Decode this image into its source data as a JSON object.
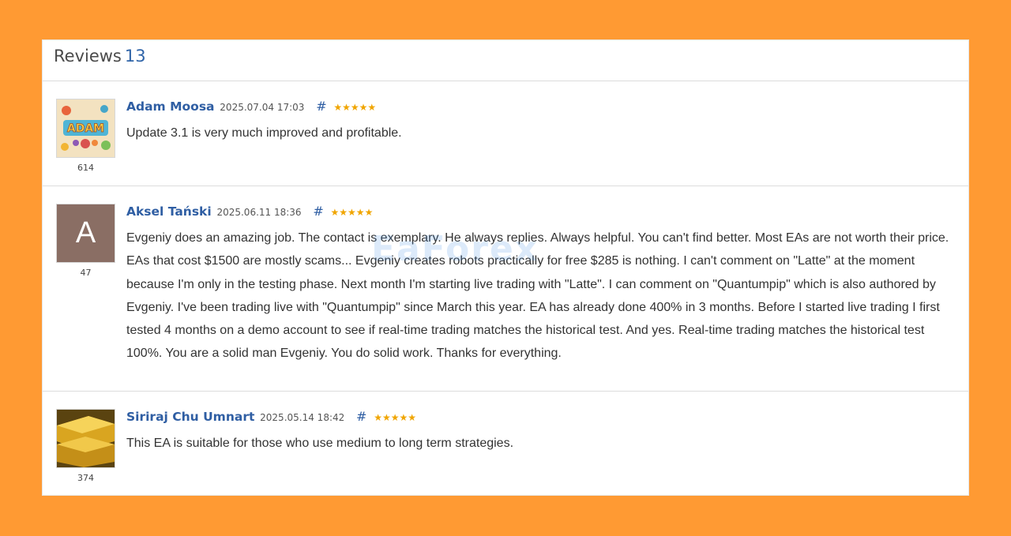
{
  "header": {
    "title": "Reviews",
    "count": "13"
  },
  "watermark": "EaForex",
  "reviews": [
    {
      "author": "Adam Moosa",
      "date": "2025.07.04 17:03",
      "hash": "#",
      "stars": "★★★★★",
      "rating": "614",
      "text": "Update 3.1 is very much improved and profitable."
    },
    {
      "author": "Aksel Tański",
      "date": "2025.06.11 18:36",
      "hash": "#",
      "stars": "★★★★★",
      "rating": "47",
      "avatar_letter": "A",
      "text": "Evgeniy does an amazing job. The contact is exemplary. He always replies. Always helpful. You can't find better. Most EAs are not worth their price. EAs that cost $1500 are mostly scams... Evgeniy creates robots practically for free $285 is nothing. I can't comment on \"Latte\" at the moment because I'm only in the testing phase. Next month I'm starting live trading with \"Latte\". I can comment on \"Quantumpip\" which is also authored by Evgeniy. I've been trading live with \"Quantumpip\" since March this year. EA has already done 400% in 3 months. Before I started live trading I first tested 4 months on a demo account to see if real-time trading matches the historical test. And yes. Real-time trading matches the historical test 100%. You are a solid man Evgeniy. You do solid work. Thanks for everything."
    },
    {
      "author": "Siriraj Chu Umnart",
      "date": "2025.05.14 18:42",
      "hash": "#",
      "stars": "★★★★★",
      "rating": "374",
      "text": "This EA is suitable for those who use medium to long term strategies."
    }
  ]
}
